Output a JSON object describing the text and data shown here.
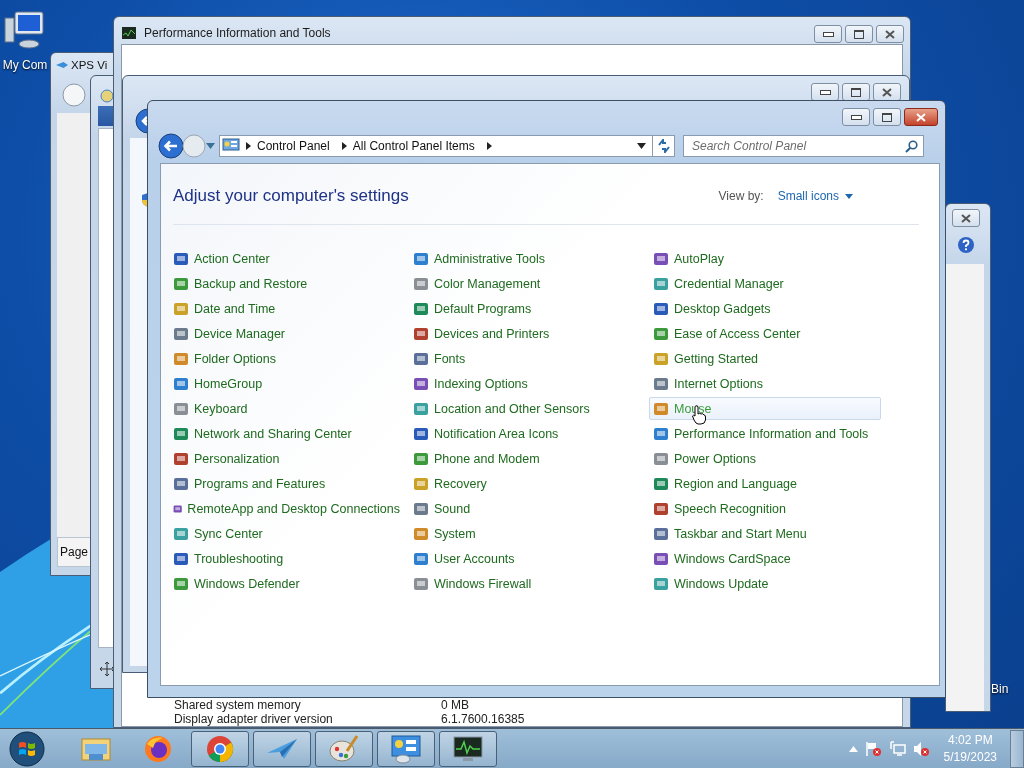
{
  "desktop": {
    "icons": [
      {
        "label": "My Com"
      },
      {
        "label": "Bin"
      }
    ]
  },
  "xps_viewer": {
    "title": "XPS Vi",
    "page_button": "Page"
  },
  "performance_window": {
    "title": "Performance Information and Tools",
    "rows": [
      {
        "label": "Shared system memory",
        "value": "0 MB"
      },
      {
        "label": "Display adapter driver version",
        "value": "6.1.7600.16385"
      }
    ]
  },
  "control_panel": {
    "breadcrumb": [
      "Control Panel",
      "All Control Panel Items"
    ],
    "search": {
      "placeholder": "Search Control Panel"
    },
    "heading": "Adjust your computer's settings",
    "view_by": {
      "label": "View by:",
      "value": "Small icons"
    },
    "columns": [
      {
        "items": [
          {
            "label": "Action Center",
            "hovered": false
          },
          {
            "label": "Backup and Restore",
            "hovered": false
          },
          {
            "label": "Date and Time",
            "hovered": false
          },
          {
            "label": "Device Manager",
            "hovered": false
          },
          {
            "label": "Folder Options",
            "hovered": false
          },
          {
            "label": "HomeGroup",
            "hovered": false
          },
          {
            "label": "Keyboard",
            "hovered": false
          },
          {
            "label": "Network and Sharing Center",
            "hovered": false
          },
          {
            "label": "Personalization",
            "hovered": false
          },
          {
            "label": "Programs and Features",
            "hovered": false
          },
          {
            "label": "RemoteApp and Desktop Connections",
            "hovered": false
          },
          {
            "label": "Sync Center",
            "hovered": false
          },
          {
            "label": "Troubleshooting",
            "hovered": false
          },
          {
            "label": "Windows Defender",
            "hovered": false
          }
        ]
      },
      {
        "items": [
          {
            "label": "Administrative Tools",
            "hovered": false
          },
          {
            "label": "Color Management",
            "hovered": false
          },
          {
            "label": "Default Programs",
            "hovered": false
          },
          {
            "label": "Devices and Printers",
            "hovered": false
          },
          {
            "label": "Fonts",
            "hovered": false
          },
          {
            "label": "Indexing Options",
            "hovered": false
          },
          {
            "label": "Location and Other Sensors",
            "hovered": false
          },
          {
            "label": "Notification Area Icons",
            "hovered": false
          },
          {
            "label": "Phone and Modem",
            "hovered": false
          },
          {
            "label": "Recovery",
            "hovered": false
          },
          {
            "label": "Sound",
            "hovered": false
          },
          {
            "label": "System",
            "hovered": false
          },
          {
            "label": "User Accounts",
            "hovered": false
          },
          {
            "label": "Windows Firewall",
            "hovered": false
          }
        ]
      },
      {
        "items": [
          {
            "label": "AutoPlay",
            "hovered": false
          },
          {
            "label": "Credential Manager",
            "hovered": false
          },
          {
            "label": "Desktop Gadgets",
            "hovered": false
          },
          {
            "label": "Ease of Access Center",
            "hovered": false
          },
          {
            "label": "Getting Started",
            "hovered": false
          },
          {
            "label": "Internet Options",
            "hovered": false
          },
          {
            "label": "Mouse",
            "hovered": true
          },
          {
            "label": "Performance Information and Tools",
            "hovered": false
          },
          {
            "label": "Power Options",
            "hovered": false
          },
          {
            "label": "Region and Language",
            "hovered": false
          },
          {
            "label": "Speech Recognition",
            "hovered": false
          },
          {
            "label": "Taskbar and Start Menu",
            "hovered": false
          },
          {
            "label": "Windows CardSpace",
            "hovered": false
          },
          {
            "label": "Windows Update",
            "hovered": false
          }
        ]
      }
    ]
  },
  "taskbar": {
    "apps": [
      {
        "kind": "explorer",
        "running": false
      },
      {
        "kind": "firefox",
        "running": false
      },
      {
        "kind": "chrome",
        "running": true
      },
      {
        "kind": "plane",
        "running": true
      },
      {
        "kind": "paint",
        "running": true
      },
      {
        "kind": "control",
        "running": true
      },
      {
        "kind": "monitor",
        "running": true
      }
    ],
    "clock": {
      "time": "4:02 PM",
      "date": "5/19/2023"
    }
  }
}
